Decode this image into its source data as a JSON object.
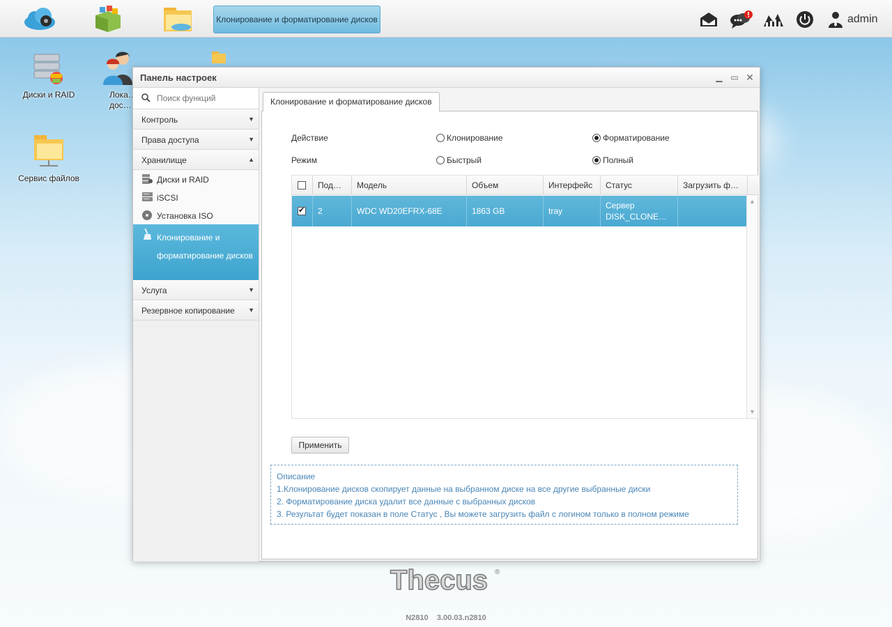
{
  "taskbar": {
    "active_app_label": "Клонирование и форматирование дисков",
    "user_label": "admin"
  },
  "desktop": {
    "icons": [
      {
        "label": "Диски и RAID"
      },
      {
        "label": "Лока…\nдос…"
      },
      {
        "label": "Сервис файлов"
      }
    ]
  },
  "window": {
    "title": "Панель настроек",
    "search_placeholder": "Поиск функций",
    "sidebar": {
      "sections": [
        {
          "label": "Контроль"
        },
        {
          "label": "Права доступа"
        },
        {
          "label": "Хранилище"
        },
        {
          "label": "Услуга"
        },
        {
          "label": "Резервное копирование"
        }
      ],
      "storage_items": [
        {
          "label": "Диски и RAID"
        },
        {
          "label": "iSCSI"
        },
        {
          "label": "Установка ISO"
        },
        {
          "label": "Клонирование и форматирование дисков"
        }
      ]
    },
    "tab_label": "Клонирование и форматирование дисков",
    "form": {
      "action_label": "Действие",
      "mode_label": "Режим",
      "action_options": [
        "Клонирование",
        "Форматирование"
      ],
      "action_selected": "Форматирование",
      "mode_options": [
        "Быстрый",
        "Полный"
      ],
      "mode_selected": "Полный"
    },
    "table": {
      "columns": [
        "Под…",
        "Модель",
        "Объем",
        "Интерфейс",
        "Статус",
        "Загрузить ф…"
      ],
      "rows": [
        {
          "slot": "2",
          "model": "WDC WD20EFRX-68E",
          "size": "1863 GB",
          "interface": "tray",
          "status": "Сервер DISK_CLONE…",
          "download": "",
          "checked": true
        }
      ]
    },
    "apply_label": "Применить",
    "description": {
      "title": "Описание",
      "lines": [
        "1.Клонирование дисков скопирует данные на выбранном диске на все другие выбранные диски",
        "2. Форматирование диска удалит все данные с выбранных дисков",
        "3. Результат будет показан в поле Статус , Вы можете загрузить файл с логином только в полном режиме"
      ]
    }
  },
  "footer": {
    "brand": "Thecus",
    "version": "N2810    3.00.03.n2810"
  },
  "colors": {
    "accent": "#4aa9d2",
    "description_text": "#4a86b6"
  }
}
